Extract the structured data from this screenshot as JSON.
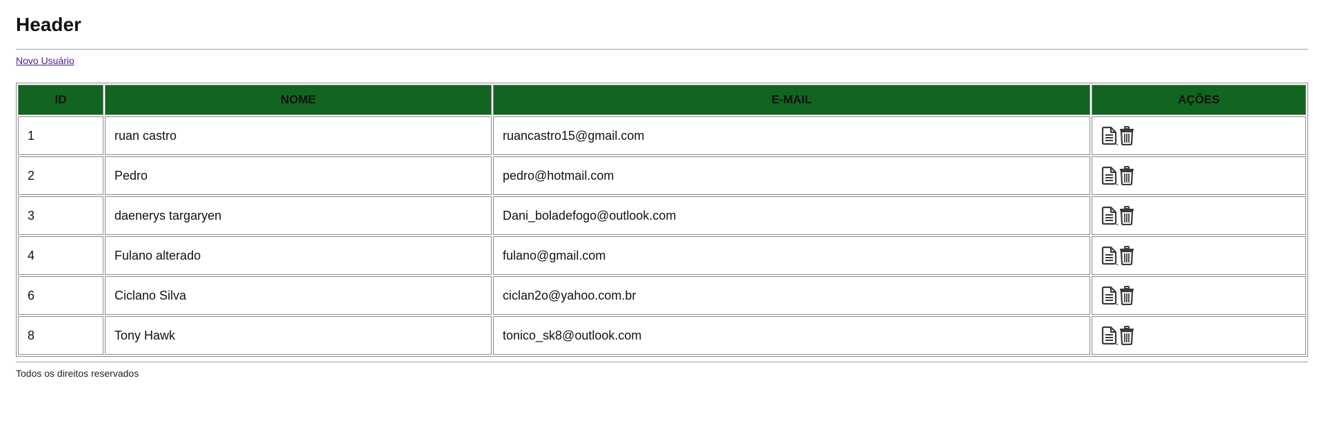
{
  "header": {
    "title": "Header"
  },
  "new_user_link": "Novo Usuário",
  "table": {
    "columns": [
      "ID",
      "NOME",
      "E-MAIL",
      "AÇÕES"
    ],
    "rows": [
      {
        "id": "1",
        "nome": "ruan castro",
        "email": "ruancastro15@gmail.com"
      },
      {
        "id": "2",
        "nome": "Pedro",
        "email": "pedro@hotmail.com"
      },
      {
        "id": "3",
        "nome": "daenerys targaryen",
        "email": "Dani_boladefogo@outlook.com"
      },
      {
        "id": "4",
        "nome": "Fulano alterado",
        "email": "fulano@gmail.com"
      },
      {
        "id": "6",
        "nome": "Ciclano Silva",
        "email": "ciclan2o@yahoo.com.br"
      },
      {
        "id": "8",
        "nome": "Tony Hawk",
        "email": "tonico_sk8@outlook.com"
      }
    ],
    "row_actions": [
      {
        "icon": "document-edit-icon"
      },
      {
        "icon": "trash-delete-icon"
      }
    ]
  },
  "footer": {
    "text": "Todos os direitos reservados"
  },
  "colors": {
    "header_bg": "#116521",
    "link": "#551a8b",
    "border": "#8a8a8a"
  }
}
